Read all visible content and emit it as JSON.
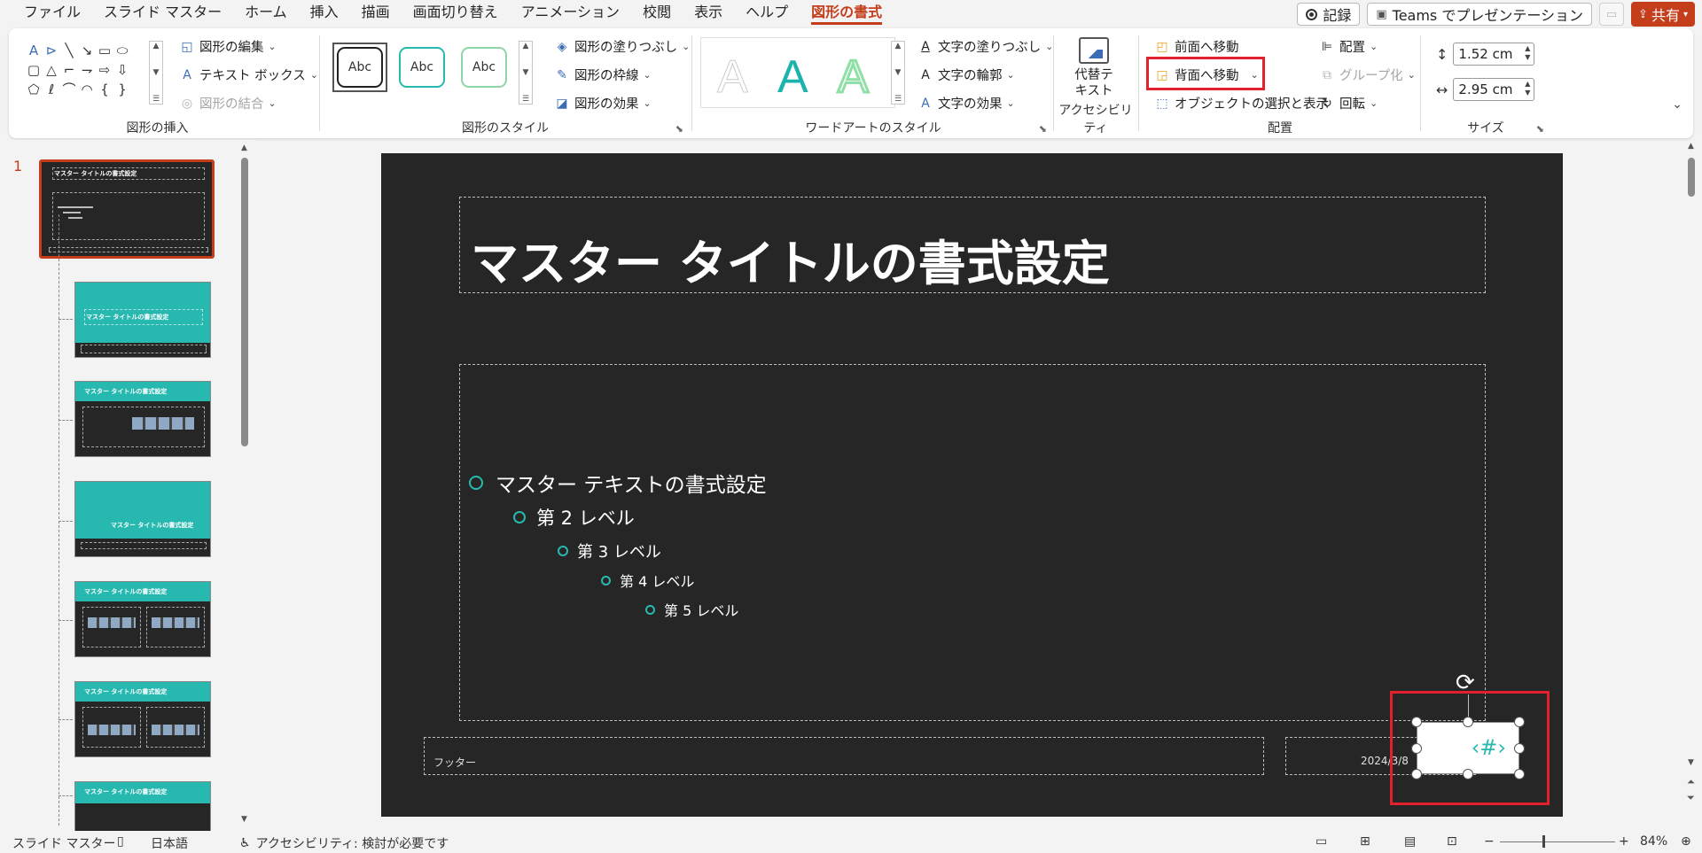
{
  "menu": {
    "tabs": [
      "ファイル",
      "スライド マスター",
      "ホーム",
      "挿入",
      "描画",
      "画面切り替え",
      "アニメーション",
      "校閲",
      "表示",
      "ヘルプ",
      "図形の書式"
    ],
    "active_tab": "図形の書式",
    "record_label": "記録",
    "teams_label": "Teams でプレゼンテーション",
    "share_label": "共有"
  },
  "ribbon": {
    "insert_shapes": {
      "label": "図形の挿入",
      "edit_shape": "図形の編集",
      "text_box": "テキスト ボックス",
      "merge_shapes": "図形の結合"
    },
    "shape_styles": {
      "label": "図形のスタイル",
      "sample": "Abc",
      "fill": "図形の塗りつぶし",
      "outline": "図形の枠線",
      "effects": "図形の効果"
    },
    "wordart": {
      "label": "ワードアートのスタイル",
      "letter": "A",
      "text_fill": "文字の塗りつぶし",
      "text_outline": "文字の輪郭",
      "text_effects": "文字の効果"
    },
    "accessibility": {
      "label": "アクセシビリティ",
      "alt_text": "代替テキスト"
    },
    "arrange": {
      "label": "配置",
      "bring_forward": "前面へ移動",
      "send_backward": "背面へ移動",
      "selection_pane": "オブジェクトの選択と表示",
      "align": "配置",
      "group": "グループ化",
      "rotate": "回転"
    },
    "size": {
      "label": "サイズ",
      "height": "1.52 cm",
      "width": "2.95 cm"
    }
  },
  "panel": {
    "slide_number": "1",
    "master_title": "マスター タイトルの書式設定",
    "layouts": [
      {
        "title": "マスター タイトルの書式設定"
      },
      {
        "title": "マスター タイトルの書式設定"
      },
      {
        "title": "マスター タイトルの書式設定"
      },
      {
        "title": "マスター タイトルの書式設定"
      },
      {
        "title": "マスター タイトルの書式設定"
      },
      {
        "title": "マスター タイトルの書式設定"
      }
    ]
  },
  "slide": {
    "title": "マスター タイトルの書式設定",
    "bullets": [
      "マスター テキストの書式設定",
      "第 2 レベル",
      "第 3 レベル",
      "第 4 レベル",
      "第 5 レベル"
    ],
    "footer": "フッター",
    "date": "2024/3/8",
    "slide_number_placeholder": "‹#›"
  },
  "status": {
    "view": "スライド マスター",
    "language": "日本語",
    "accessibility": "アクセシビリティ: 検討が必要です",
    "zoom": "84%"
  },
  "colors": {
    "accent": "#c43e1c",
    "teal": "#27b9b0",
    "slide_bg": "#262626",
    "highlight": "#e2202e"
  }
}
